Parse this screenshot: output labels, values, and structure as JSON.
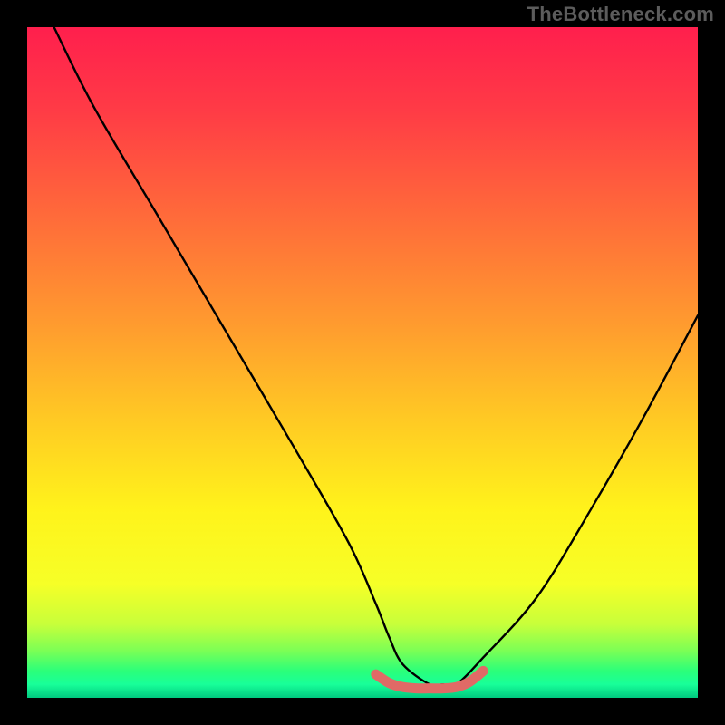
{
  "watermark": "TheBottleneck.com",
  "chart_data": {
    "type": "line",
    "title": "",
    "xlabel": "",
    "ylabel": "",
    "xlim": [
      0,
      100
    ],
    "ylim": [
      0,
      100
    ],
    "series": [
      {
        "name": "v-curve",
        "color": "#000000",
        "x": [
          4,
          10,
          20,
          30,
          40,
          48,
          52,
          54,
          56,
          60,
          62,
          64,
          68,
          76,
          84,
          92,
          100
        ],
        "values": [
          100,
          88,
          71,
          54,
          37,
          23,
          14,
          9,
          5,
          2,
          2,
          2,
          6,
          15,
          28,
          42,
          57
        ]
      },
      {
        "name": "flat-bottom-highlight",
        "color": "#e06a66",
        "x": [
          52,
          54,
          56,
          58,
          60,
          62,
          64,
          66,
          68
        ],
        "values": [
          3.5,
          2.2,
          1.6,
          1.4,
          1.4,
          1.4,
          1.6,
          2.4,
          4.0
        ]
      }
    ],
    "background_gradient": {
      "stops": [
        {
          "pct": 0,
          "color": "#ff1f4d"
        },
        {
          "pct": 12,
          "color": "#ff3a46"
        },
        {
          "pct": 28,
          "color": "#ff6a3a"
        },
        {
          "pct": 44,
          "color": "#ff9a2f"
        },
        {
          "pct": 58,
          "color": "#ffc824"
        },
        {
          "pct": 72,
          "color": "#fff31b"
        },
        {
          "pct": 83,
          "color": "#f6ff27"
        },
        {
          "pct": 89,
          "color": "#c8ff3a"
        },
        {
          "pct": 93,
          "color": "#7bff55"
        },
        {
          "pct": 96,
          "color": "#2bff7a"
        },
        {
          "pct": 98,
          "color": "#18ff99"
        },
        {
          "pct": 100,
          "color": "#00c97f"
        }
      ]
    }
  }
}
